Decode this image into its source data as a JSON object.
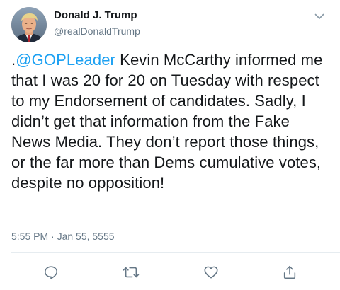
{
  "tweet": {
    "author": {
      "display_name": "Donald J. Trump",
      "handle": "@realDonaldTrump",
      "avatar_icon": "profile-photo"
    },
    "text": {
      "prefix": ".",
      "mention": "@GOPLeader",
      "body": " Kevin McCarthy informed me that I was 20 for 20 on Tuesday with respect to my Endorsement of candidates. Sadly, I didn’t get that information from the Fake News Media. They don’t report those things, or the far more than Dems cumulative votes, despite no opposition!"
    },
    "timestamp": "5:55 PM · Jan 55, 5555",
    "menu_icon": "chevron-down-icon",
    "actions": {
      "reply_icon": "reply-icon",
      "retweet_icon": "retweet-icon",
      "like_icon": "heart-icon",
      "share_icon": "share-icon"
    },
    "colors": {
      "link": "#1da1f2",
      "text": "#14171a",
      "secondary": "#657786",
      "divider": "#e6ecf0"
    }
  }
}
